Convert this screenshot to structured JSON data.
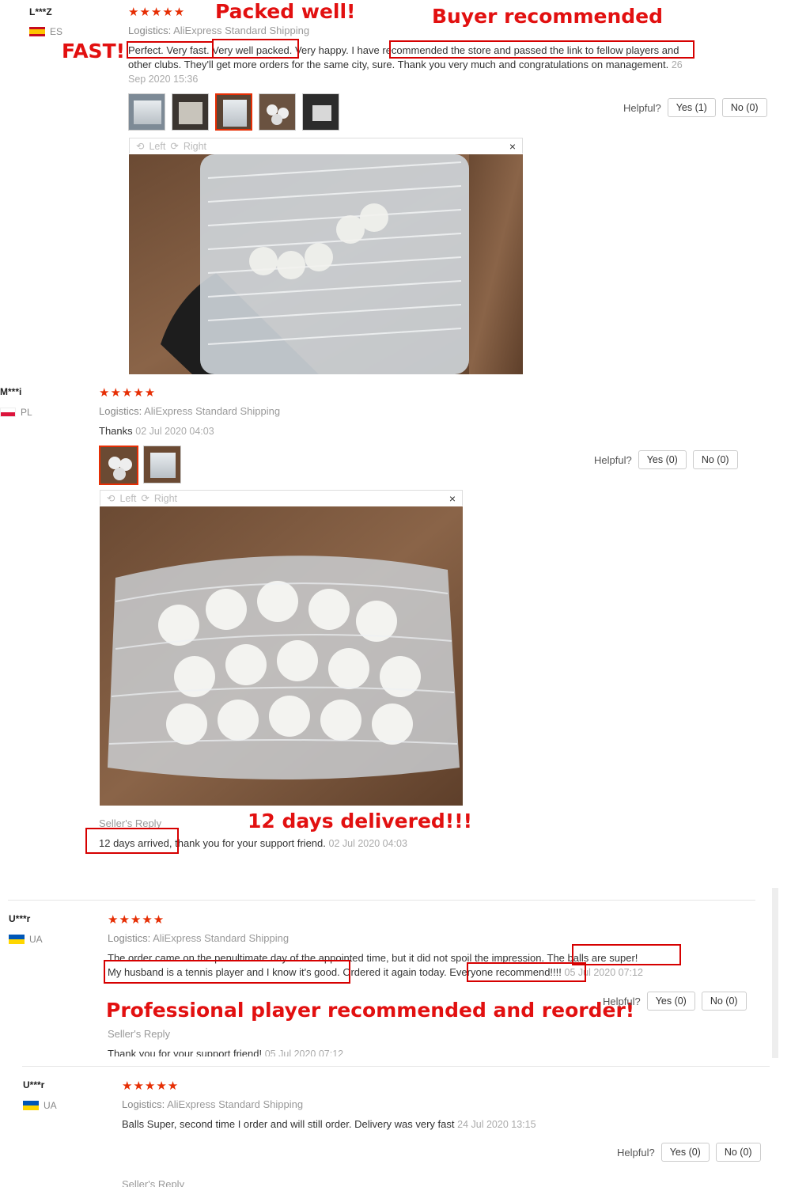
{
  "stars": "★★★★★",
  "logistics_label": "Logistics:",
  "logistics_value": "AliExpress Standard Shipping",
  "helpful_label": "Helpful?",
  "viewer": {
    "left": "Left",
    "right": "Right",
    "close": "×"
  },
  "seller_reply_label": "Seller's Reply",
  "annotations": {
    "packed": "Packed well!",
    "buyer": "Buyer recommended",
    "fast": "FAST!",
    "twelve": "12 days delivered!!!",
    "pro": "Professional player recommended and reorder!"
  },
  "reviews": [
    {
      "user": "L***Z",
      "country": "ES",
      "text_a": "Perfect. Very fast.",
      "text_b": "Very well packed.",
      "text_c": "Very happy. I have",
      "text_d": "recommended the store and passed the link to fellow players",
      "text_e": "and other clubs. They'll get more orders for the same city, sure. Thank you very much and congratulations on",
      "text_f": "management.",
      "date": "26 Sep 2020 15:36",
      "yes": "Yes (1)",
      "no": "No (0)"
    },
    {
      "user": "M***i",
      "country": "PL",
      "text": "Thanks",
      "date": "02 Jul 2020 04:03",
      "yes": "Yes (0)",
      "no": "No (0)",
      "seller_reply": "12 days arrived, thank you for your support friend.",
      "seller_date": "02 Jul 2020 04:03"
    },
    {
      "user": "U***r",
      "country": "UA",
      "text_a": "The order came on the penultimate day of the appointed time, but it did not spoil the impression.",
      "text_b": "The balls are super!",
      "text_c": "My husband is a tennis player and I know it's good.",
      "text_d": "Ordered it again today.",
      "text_e": "Everyone recommend!!!!",
      "date": "05 Jul 2020 07:12",
      "yes": "Yes (0)",
      "no": "No (0)",
      "seller_reply": "Thank you for your support friend!",
      "seller_date": "05 Jul 2020 07:12"
    },
    {
      "user": "U***r",
      "country": "UA",
      "text": "Balls Super, second time I order and will still order. Delivery was very fast",
      "date": "24 Jul 2020 13:15",
      "yes": "Yes (0)",
      "no": "No (0)"
    }
  ]
}
